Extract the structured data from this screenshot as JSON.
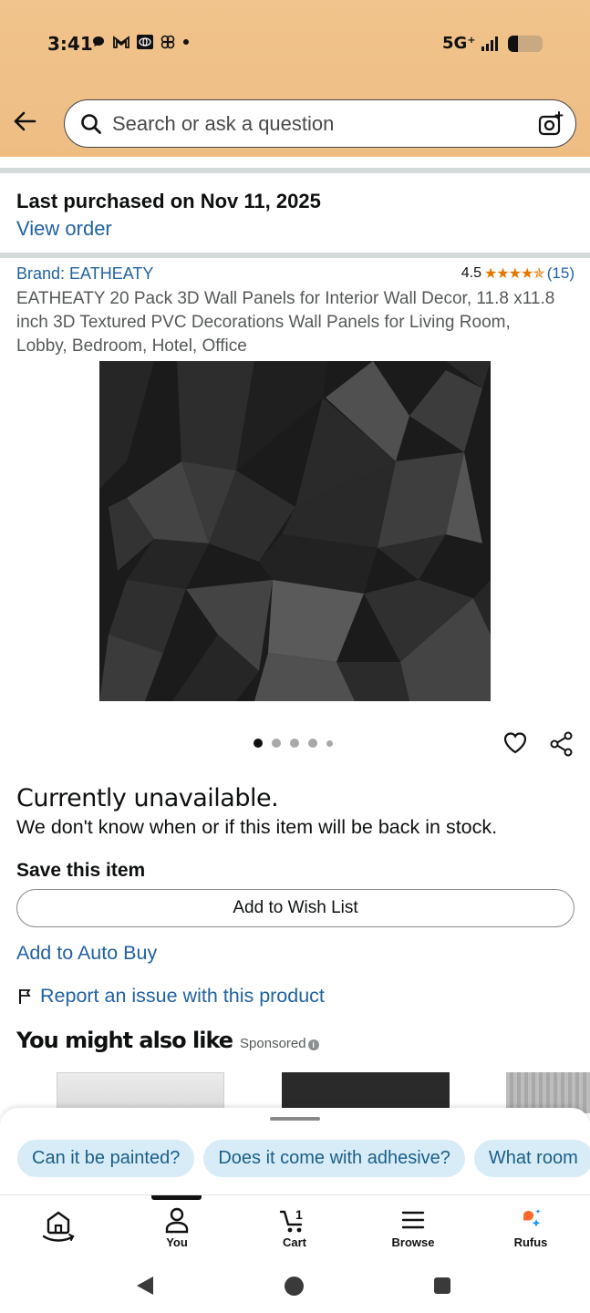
{
  "status_bar": {
    "time": "3:41",
    "network": "5G⁺",
    "icons": [
      "chat-icon",
      "gmail-icon",
      "toyota-icon",
      "pinwheel-icon",
      "dot-icon"
    ],
    "battery_level": 0.25
  },
  "search": {
    "placeholder": "Search or ask a question"
  },
  "purchase": {
    "text": "Last purchased on Nov 11, 2025",
    "link": "View order"
  },
  "product": {
    "brand": "Brand: EATHEATY",
    "rating": "4.5",
    "review_count": "(15)",
    "stars": "★★★★✯",
    "title": "EATHEATY 20 Pack 3D Wall Panels for Interior Wall Decor, 11.8 x11.8 inch 3D Textured PVC Decorations Wall Panels for Living Room, Lobby, Bedroom, Hotel, Office",
    "image_count": 5,
    "current_image": 1
  },
  "availability": {
    "headline": "Currently unavailable.",
    "detail": "We don't know when or if this item will be back in stock."
  },
  "save": {
    "title": "Save this item",
    "wish_list_button": "Add to Wish List",
    "auto_buy_link": "Add to Auto Buy",
    "report_link": "Report an issue with this product"
  },
  "recommendations": {
    "title": "You might also like",
    "sponsored": "Sponsored"
  },
  "rufus_chips": [
    "Can it be painted?",
    "Does it come with adhesive?",
    "What room"
  ],
  "bottom_nav": {
    "items": [
      {
        "label": "",
        "icon": "home-icon"
      },
      {
        "label": "You",
        "icon": "person-icon"
      },
      {
        "label": "Cart",
        "icon": "cart-icon",
        "badge": "1"
      },
      {
        "label": "Browse",
        "icon": "menu-icon"
      },
      {
        "label": "Rufus",
        "icon": "rufus-icon"
      }
    ],
    "active": "You"
  },
  "colors": {
    "header": "#eebd84",
    "link": "#2162a1",
    "star": "#e77600",
    "chip_bg": "#d7ecf6"
  }
}
